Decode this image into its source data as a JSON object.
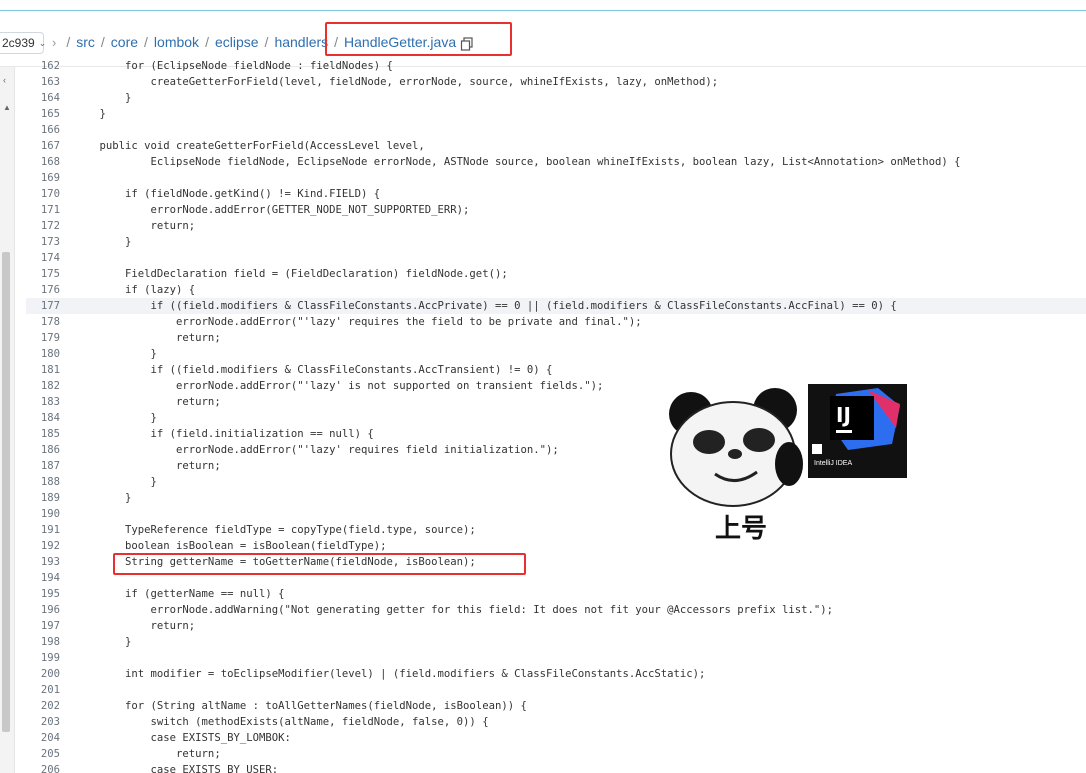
{
  "header": {
    "branch": "2c939",
    "breadcrumb": [
      "src",
      "core",
      "lombok",
      "eclipse",
      "handlers"
    ],
    "file": "HandleGetter.java"
  },
  "sticker": {
    "caption": "上号",
    "app_label": "IntelliJ IDEA",
    "app_icon_letters": "IJ"
  },
  "icons": {
    "copy": "copy-icon",
    "branch_chevron": "chevron-down-icon",
    "nav_chevron": "chevron-right-icon"
  },
  "colors": {
    "link": "#2f6fb0",
    "annotation_red": "#e8302f",
    "keyword": "#6f42c1",
    "string": "#032f62",
    "type": "#005cc5"
  },
  "code_lines": [
    {
      "n": "162",
      "t": "        for (EclipseNode fieldNode : fieldNodes) {"
    },
    {
      "n": "163",
      "t": "            createGetterForField(level, fieldNode, errorNode, source, whineIfExists, lazy, onMethod);"
    },
    {
      "n": "164",
      "t": "        }"
    },
    {
      "n": "165",
      "t": "    }"
    },
    {
      "n": "166",
      "t": ""
    },
    {
      "n": "167",
      "t": "    public void createGetterForField(AccessLevel level,"
    },
    {
      "n": "168",
      "t": "            EclipseNode fieldNode, EclipseNode errorNode, ASTNode source, boolean whineIfExists, boolean lazy, List<Annotation> onMethod) {"
    },
    {
      "n": "169",
      "t": ""
    },
    {
      "n": "170",
      "t": "        if (fieldNode.getKind() != Kind.FIELD) {"
    },
    {
      "n": "171",
      "t": "            errorNode.addError(GETTER_NODE_NOT_SUPPORTED_ERR);"
    },
    {
      "n": "172",
      "t": "            return;"
    },
    {
      "n": "173",
      "t": "        }"
    },
    {
      "n": "174",
      "t": ""
    },
    {
      "n": "175",
      "t": "        FieldDeclaration field = (FieldDeclaration) fieldNode.get();"
    },
    {
      "n": "176",
      "t": "        if (lazy) {"
    },
    {
      "n": "177",
      "t": "            if ((field.modifiers & ClassFileConstants.AccPrivate) == 0 || (field.modifiers & ClassFileConstants.AccFinal) == 0) {"
    },
    {
      "n": "178",
      "t": "                errorNode.addError(\"'lazy' requires the field to be private and final.\");"
    },
    {
      "n": "179",
      "t": "                return;"
    },
    {
      "n": "180",
      "t": "            }"
    },
    {
      "n": "181",
      "t": "            if ((field.modifiers & ClassFileConstants.AccTransient) != 0) {"
    },
    {
      "n": "182",
      "t": "                errorNode.addError(\"'lazy' is not supported on transient fields.\");"
    },
    {
      "n": "183",
      "t": "                return;"
    },
    {
      "n": "184",
      "t": "            }"
    },
    {
      "n": "185",
      "t": "            if (field.initialization == null) {"
    },
    {
      "n": "186",
      "t": "                errorNode.addError(\"'lazy' requires field initialization.\");"
    },
    {
      "n": "187",
      "t": "                return;"
    },
    {
      "n": "188",
      "t": "            }"
    },
    {
      "n": "189",
      "t": "        }"
    },
    {
      "n": "190",
      "t": ""
    },
    {
      "n": "191",
      "t": "        TypeReference fieldType = copyType(field.type, source);"
    },
    {
      "n": "192",
      "t": "        boolean isBoolean = isBoolean(fieldType);"
    },
    {
      "n": "193",
      "t": "        String getterName = toGetterName(fieldNode, isBoolean);"
    },
    {
      "n": "194",
      "t": ""
    },
    {
      "n": "195",
      "t": "        if (getterName == null) {"
    },
    {
      "n": "196",
      "t": "            errorNode.addWarning(\"Not generating getter for this field: It does not fit your @Accessors prefix list.\");"
    },
    {
      "n": "197",
      "t": "            return;"
    },
    {
      "n": "198",
      "t": "        }"
    },
    {
      "n": "199",
      "t": ""
    },
    {
      "n": "200",
      "t": "        int modifier = toEclipseModifier(level) | (field.modifiers & ClassFileConstants.AccStatic);"
    },
    {
      "n": "201",
      "t": ""
    },
    {
      "n": "202",
      "t": "        for (String altName : toAllGetterNames(fieldNode, isBoolean)) {"
    },
    {
      "n": "203",
      "t": "            switch (methodExists(altName, fieldNode, false, 0)) {"
    },
    {
      "n": "204",
      "t": "            case EXISTS_BY_LOMBOK:"
    },
    {
      "n": "205",
      "t": "                return;"
    },
    {
      "n": "206",
      "t": "            case EXISTS_BY_USER:"
    }
  ]
}
